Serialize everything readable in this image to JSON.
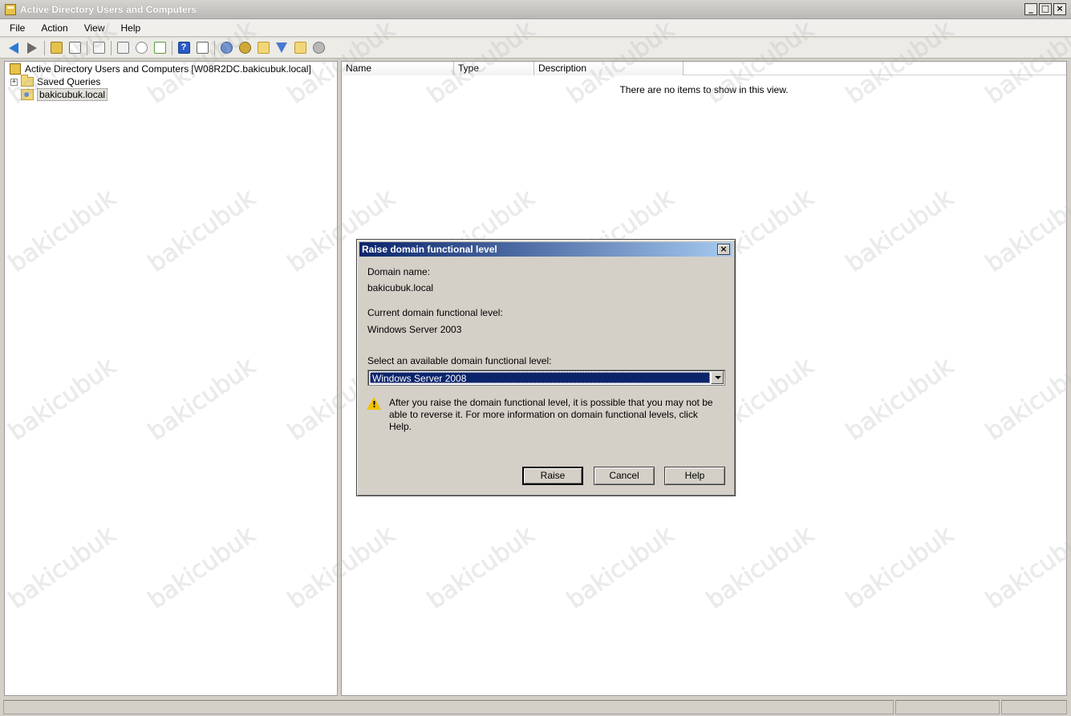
{
  "window": {
    "title": "Active Directory Users and Computers"
  },
  "menu": {
    "items": [
      "File",
      "Action",
      "View",
      "Help"
    ]
  },
  "toolbar": {
    "icons": [
      "back-icon",
      "forward-icon",
      "up-folder-icon",
      "show-hide-console-tree-icon",
      "copy-icon",
      "properties-icon",
      "refresh-icon",
      "export-list-icon",
      "help-icon",
      "show-action-pane-icon",
      "new-user-icon",
      "new-group-icon",
      "new-ou-icon",
      "filter-icon",
      "find-icon",
      "add-to-group-icon"
    ]
  },
  "tree": {
    "root": "Active Directory Users and Computers [W08R2DC.bakicubuk.local]",
    "items": [
      {
        "label": "Saved Queries",
        "expander": "+"
      },
      {
        "label": "bakicubuk.local",
        "selected": true
      }
    ]
  },
  "list": {
    "columns": [
      "Name",
      "Type",
      "Description"
    ],
    "empty_message": "There are no items to show in this view."
  },
  "dialog": {
    "title": "Raise domain functional level",
    "close_label": "×",
    "domain_name_label": "Domain name:",
    "domain_name_value": "bakicubuk.local",
    "current_level_label": "Current domain functional level:",
    "current_level_value": "Windows Server 2003",
    "select_label": "Select an available domain functional level:",
    "selected_level": "Windows Server 2008",
    "warning": "After you raise the domain functional level, it is possible that you may not be able to reverse it. For more information on domain functional levels, click Help.",
    "buttons": {
      "raise": "Raise",
      "cancel": "Cancel",
      "help": "Help"
    }
  },
  "watermark": {
    "text": "bakicubuk"
  },
  "colors": {
    "dialog_title_start": "#0a246a",
    "dialog_title_end": "#a6caf0",
    "selection": "#0a246a",
    "chrome": "#d4d0c8"
  }
}
